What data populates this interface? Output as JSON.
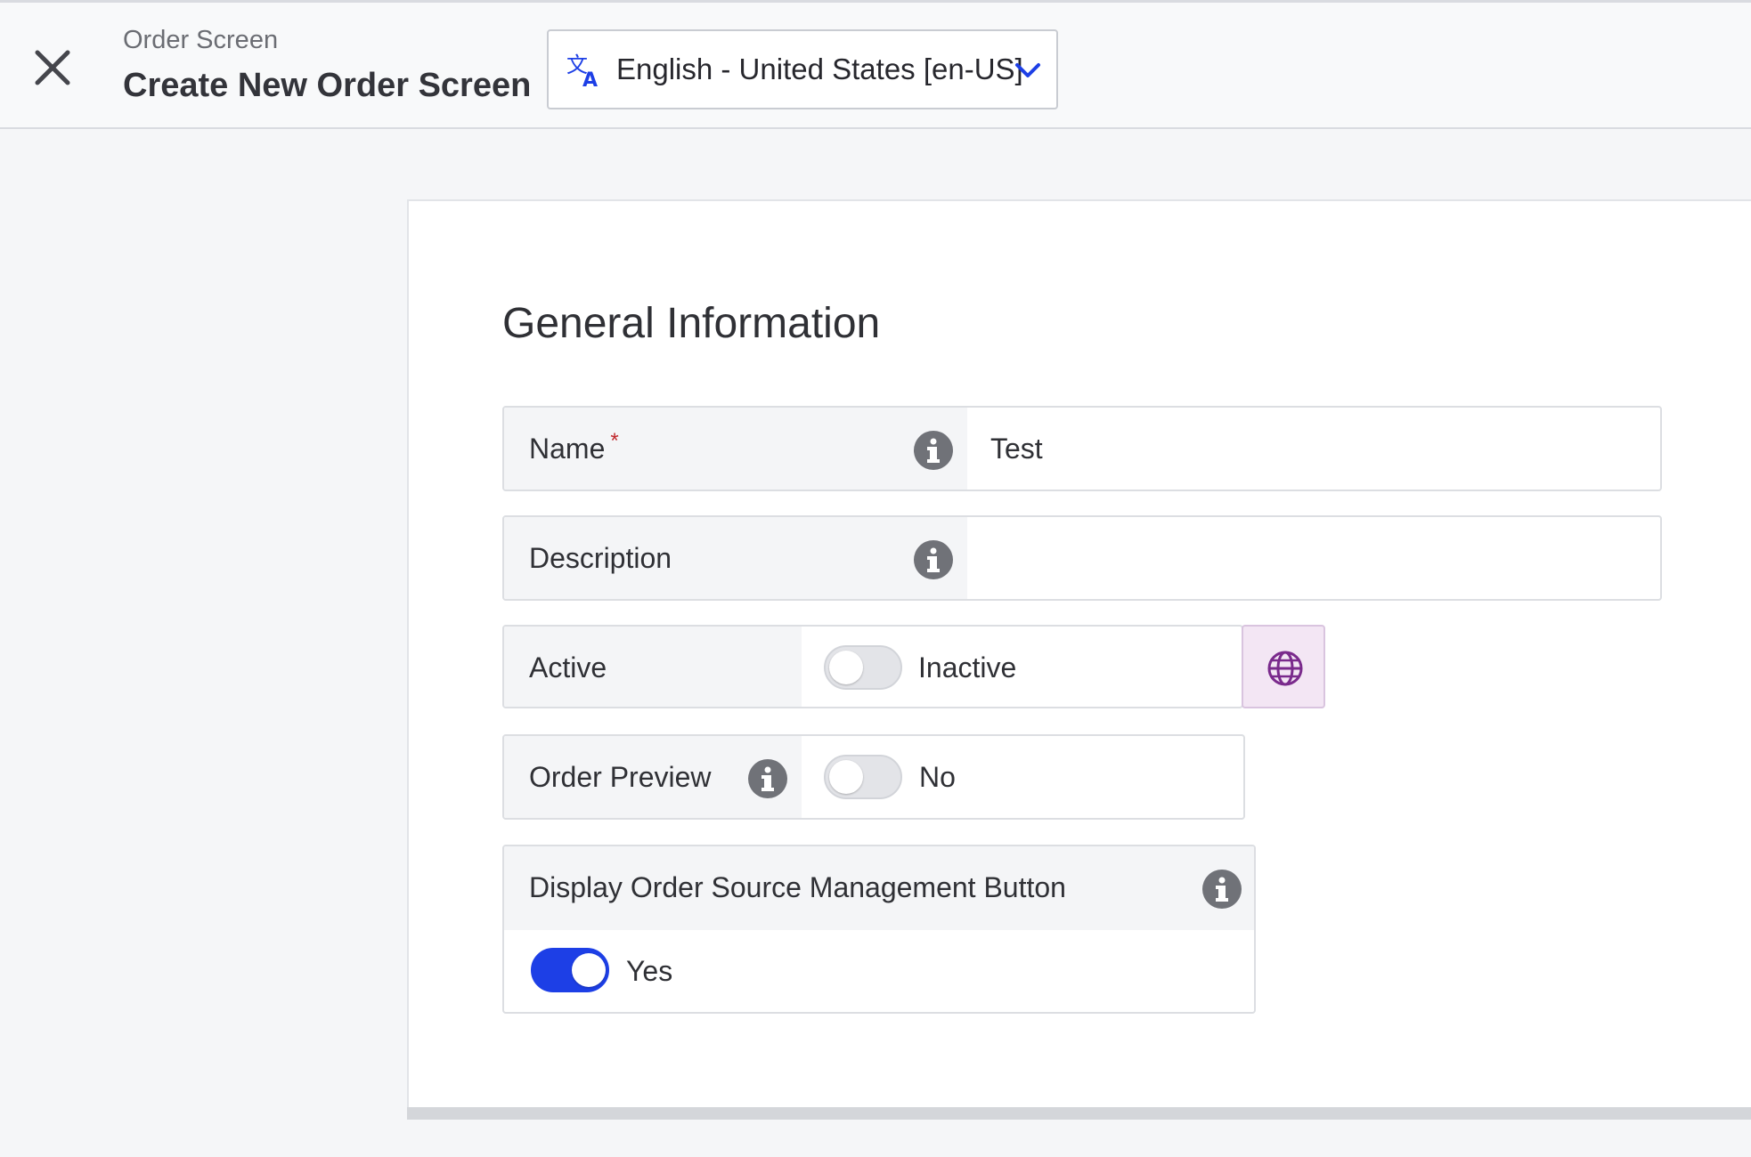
{
  "header": {
    "breadcrumb": "Order Screen",
    "title": "Create New Order Screen",
    "language": "English - United States [en-US]",
    "close_icon": "close-icon",
    "language_icon": "translate-icon"
  },
  "form": {
    "section_title": "General Information",
    "fields": {
      "name": {
        "label": "Name",
        "required_mark": "*",
        "value": "Test"
      },
      "description": {
        "label": "Description",
        "value": ""
      },
      "active": {
        "label": "Active",
        "state_label": "Inactive",
        "on": false
      },
      "order_preview": {
        "label": "Order Preview",
        "state_label": "No",
        "on": false
      },
      "display_order_source": {
        "label": "Display Order Source Management Button",
        "state_label": "Yes",
        "on": true
      }
    }
  },
  "colors": {
    "accent": "#1d3fe6",
    "required": "#c0282d",
    "globe": "#7a2a8c"
  }
}
